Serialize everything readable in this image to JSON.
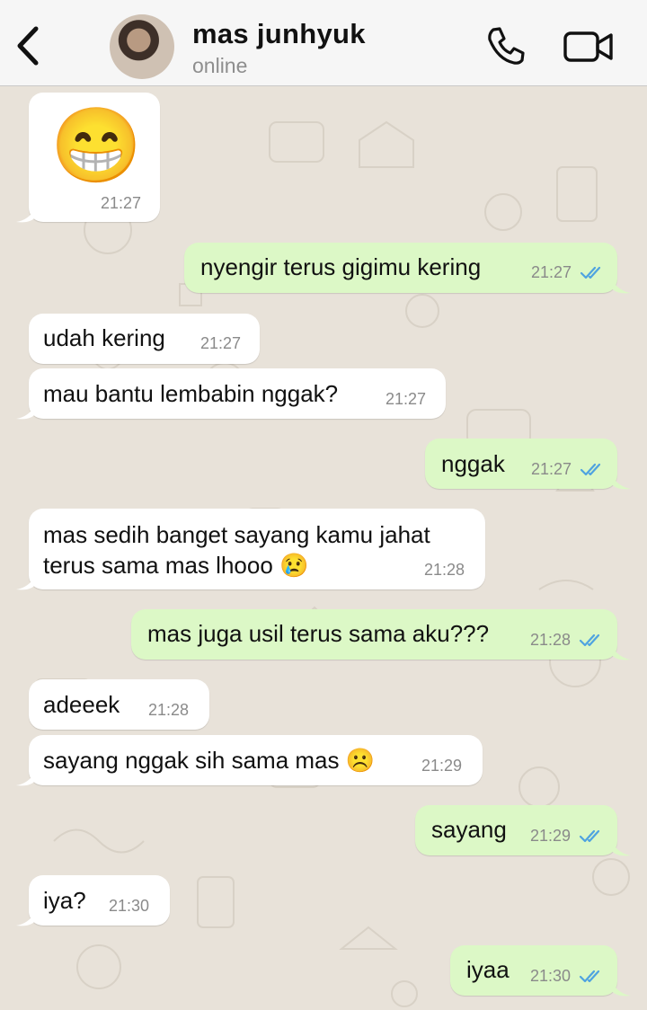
{
  "header": {
    "contact_name": "mas junhyuk",
    "status": "online",
    "back_icon": "chevron-left-icon",
    "call_icon": "phone-icon",
    "video_icon": "video-camera-icon"
  },
  "colors": {
    "incoming": "#ffffff",
    "outgoing": "#dcf8c6",
    "read_ticks": "#4fa3e0",
    "background": "#e8e2d9"
  },
  "messages": [
    {
      "side": "in",
      "emoji_sticker": "😁",
      "time": "21:27"
    },
    {
      "side": "out",
      "text": "nyengir terus gigimu kering",
      "time": "21:27",
      "read": true
    },
    {
      "side": "in",
      "text": "udah kering",
      "time": "21:27"
    },
    {
      "side": "in",
      "text": "mau bantu lembabin nggak?",
      "time": "21:27"
    },
    {
      "side": "out",
      "text": "nggak",
      "time": "21:27",
      "read": true
    },
    {
      "side": "in",
      "line1": "mas sedih banget sayang kamu jahat",
      "line2": "terus sama mas lhooo 😢",
      "time": "21:28"
    },
    {
      "side": "out",
      "text": "mas juga usil terus sama aku???",
      "time": "21:28",
      "read": true
    },
    {
      "side": "in",
      "text": "adeeek",
      "time": "21:28"
    },
    {
      "side": "in",
      "text": "sayang nggak sih sama mas ☹️",
      "time": "21:29"
    },
    {
      "side": "out",
      "text": "sayang",
      "time": "21:29",
      "read": true
    },
    {
      "side": "in",
      "text": "iya?",
      "time": "21:30"
    },
    {
      "side": "out",
      "text": "iyaa",
      "time": "21:30",
      "read": true
    }
  ]
}
